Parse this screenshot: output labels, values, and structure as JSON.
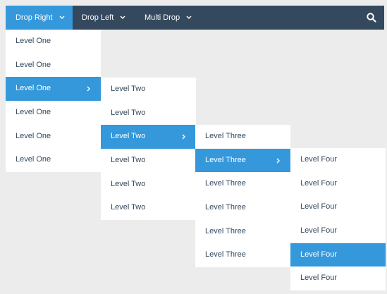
{
  "navbar": {
    "items": [
      {
        "label": "Drop Right",
        "active": true
      },
      {
        "label": "Drop Left",
        "active": false
      },
      {
        "label": "Multi Drop",
        "active": false
      }
    ],
    "search_icon": "search-icon"
  },
  "menus": {
    "level_one": {
      "items": [
        "Level One",
        "Level One",
        "Level One",
        "Level One",
        "Level One",
        "Level One"
      ],
      "active_index": 2
    },
    "level_two": {
      "items": [
        "Level Two",
        "Level Two",
        "Level Two",
        "Level Two",
        "Level Two",
        "Level Two"
      ],
      "active_index": 2
    },
    "level_three": {
      "items": [
        "Level Three",
        "Level Three",
        "Level Three",
        "Level Three",
        "Level Three",
        "Level Three"
      ],
      "active_index": 1
    },
    "level_four": {
      "items": [
        "Level Four",
        "Level Four",
        "Level Four",
        "Level Four",
        "Level Four",
        "Level Four"
      ],
      "active_index": 4
    }
  },
  "colors": {
    "navbar_bg": "#34495e",
    "accent": "#3498db",
    "menu_bg": "#ffffff",
    "menu_text": "#34495e",
    "page_bg": "#ececec"
  }
}
